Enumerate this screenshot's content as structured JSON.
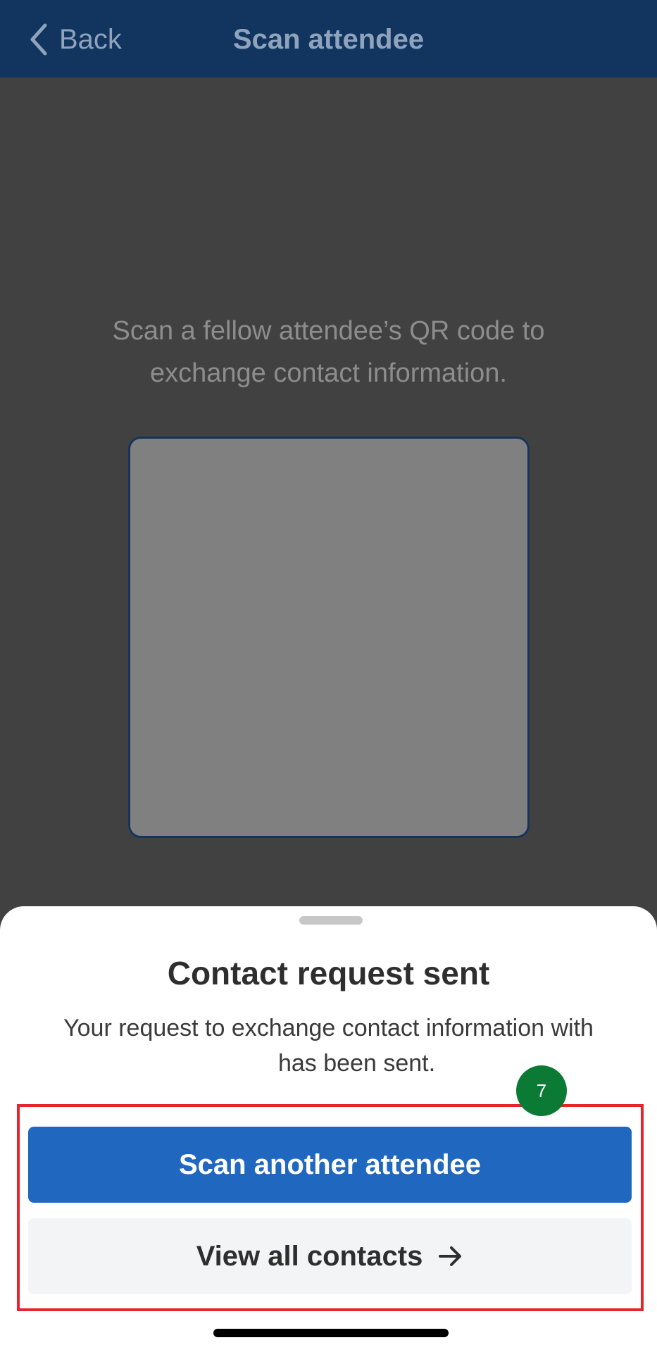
{
  "header": {
    "back_label": "Back",
    "back_icon": "chevron-left-icon",
    "title": "Scan attendee",
    "background_color": "#12355f"
  },
  "scanner": {
    "instructions": "Scan a fellow attendee’s QR code to exchange contact information."
  },
  "sheet": {
    "title": "Contact request sent",
    "message_line1": "Your request to exchange contact information with",
    "message_line2": "has been sent."
  },
  "actions": {
    "primary_label": "Scan another attendee",
    "primary_color": "#2067c0",
    "secondary_label": "View all contacts",
    "secondary_icon": "arrow-right-icon"
  },
  "annotation": {
    "step_number": "7",
    "badge_color": "#0a7a35",
    "highlight_color": "#e5252b"
  }
}
